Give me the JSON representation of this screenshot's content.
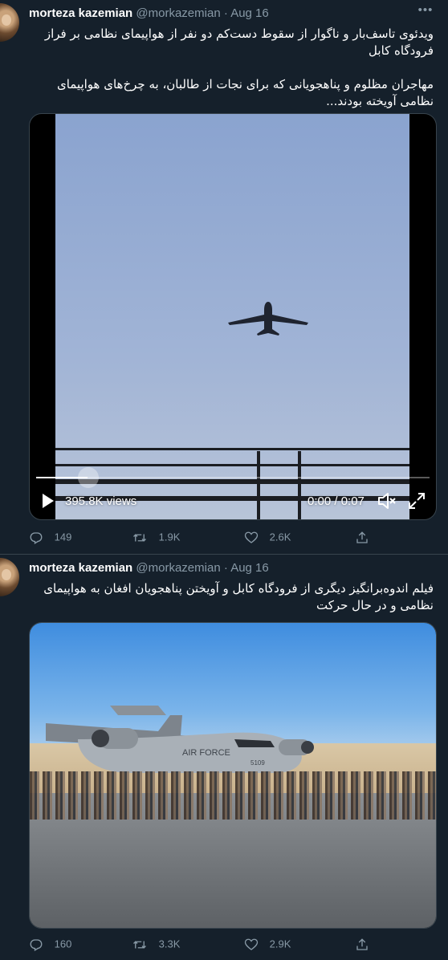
{
  "tweets": [
    {
      "author_name": "morteza kazemian",
      "author_handle": "@morkazemian",
      "dot": "·",
      "date": "Aug 16",
      "text": "ویدئوی تاسف‌بار و ناگوار از سقوط دست‌کم دو نفر از هواپیمای نظامی بر فراز فرودگاه کابل\n\nمهاجران مظلوم و پناهجویانی که برای نجات از طالبان، به چرخ‌های هواپیمای نظامی آویخته بودند...",
      "media": {
        "type": "video",
        "views": "395.8K views",
        "time": "0:00 / 0:07",
        "progress": 0.13
      },
      "actions": {
        "reply": "149",
        "retweet": "1.9K",
        "like": "2.6K"
      }
    },
    {
      "author_name": "morteza kazemian",
      "author_handle": "@morkazemian",
      "dot": "·",
      "date": "Aug 16",
      "text": "فیلم اندوه‌برانگیز دیگری از فرودگاه کابل و آویختن پناهجویان افغان به هواپیمای نظامی و در حال حرکت",
      "media": {
        "type": "image",
        "aircraft_text": "AIR FORCE",
        "tail_number": "5109"
      },
      "actions": {
        "reply": "160",
        "retweet": "3.3K",
        "like": "2.9K"
      }
    }
  ],
  "icons": {
    "more": "more-horizontal-icon",
    "reply": "reply-icon",
    "retweet": "retweet-icon",
    "like": "heart-icon",
    "share": "share-icon",
    "play": "play-icon",
    "volume": "volume-muted-icon",
    "fullscreen": "fullscreen-icon"
  },
  "colors": {
    "background": "#15202b",
    "secondary_text": "#8899a6",
    "border": "#38444d"
  }
}
